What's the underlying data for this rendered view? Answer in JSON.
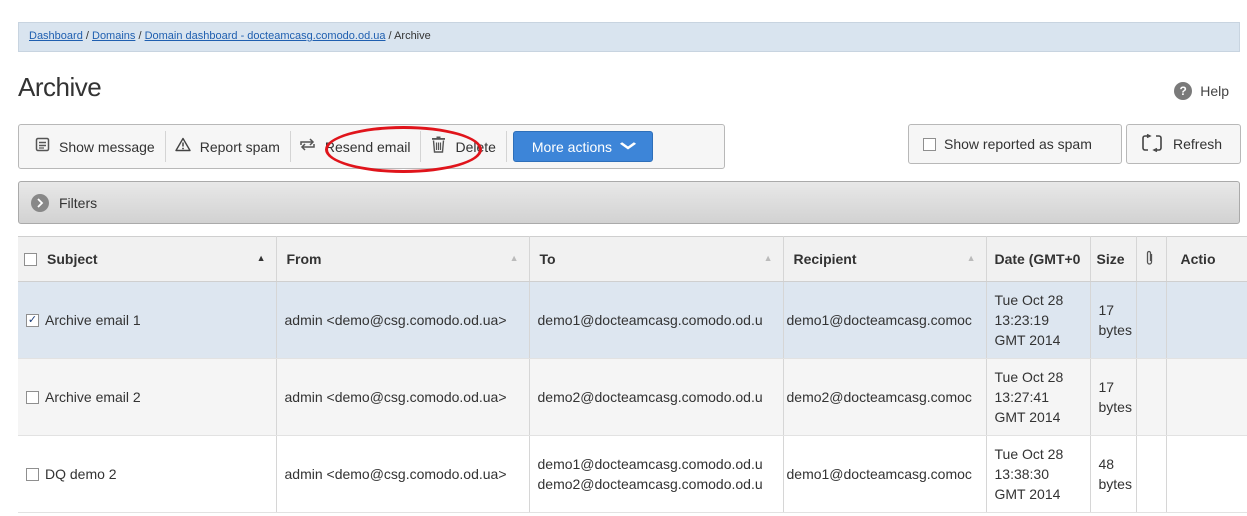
{
  "breadcrumb": {
    "links": [
      "Dashboard",
      "Domains",
      "Domain dashboard - docteamcasg.comodo.od.ua"
    ],
    "separator": " / ",
    "current": "Archive"
  },
  "page": {
    "title": "Archive"
  },
  "help": {
    "label": "Help",
    "icon": "?"
  },
  "toolbar": {
    "show_message": "Show message",
    "report_spam": "Report spam",
    "resend_email": "Resend email",
    "delete": "Delete",
    "more_actions": "More actions"
  },
  "right_actions": {
    "show_reported_spam": "Show reported as spam",
    "refresh": "Refresh"
  },
  "filters": {
    "label": "Filters"
  },
  "table": {
    "headers": {
      "subject": "Subject",
      "from": "From",
      "to": "To",
      "recipient": "Recipient",
      "date": "Date (GMT+0",
      "size": "Size",
      "attachment": "",
      "actions": "Actio"
    },
    "rows": [
      {
        "checked": true,
        "subject": "Archive email 1",
        "from": "admin <demo@csg.comodo.od.ua>",
        "to": "demo1@docteamcasg.comodo.od.u",
        "to2": "",
        "recipient": "demo1@docteamcasg.comoc",
        "date_l1": "Tue Oct 28",
        "date_l2": "13:23:19",
        "date_l3": "GMT 2014",
        "size_l1": "17",
        "size_l2": "bytes"
      },
      {
        "checked": false,
        "subject": "Archive email 2",
        "from": "admin <demo@csg.comodo.od.ua>",
        "to": "demo2@docteamcasg.comodo.od.u",
        "to2": "",
        "recipient": "demo2@docteamcasg.comoc",
        "date_l1": "Tue Oct 28",
        "date_l2": "13:27:41",
        "date_l3": "GMT 2014",
        "size_l1": "17",
        "size_l2": "bytes"
      },
      {
        "checked": false,
        "subject": "DQ demo 2",
        "from": "admin <demo@csg.comodo.od.ua>",
        "to": "demo1@docteamcasg.comodo.od.u",
        "to2": "demo2@docteamcasg.comodo.od.u",
        "recipient": "demo1@docteamcasg.comoc",
        "date_l1": "Tue Oct 28",
        "date_l2": "13:38:30",
        "date_l3": "GMT 2014",
        "size_l1": "48",
        "size_l2": "bytes"
      }
    ]
  },
  "colors": {
    "accent": "#3d85d8",
    "highlight": "#e0141b",
    "breadcrumb_bg": "#d9e4ef",
    "selected_row": "#dde6f0"
  },
  "icons": {
    "show_message": "message-icon",
    "report_spam": "warning-icon",
    "resend_email": "resend-icon",
    "delete": "trash-icon",
    "refresh": "refresh-icon",
    "attachment": "paperclip-icon"
  }
}
